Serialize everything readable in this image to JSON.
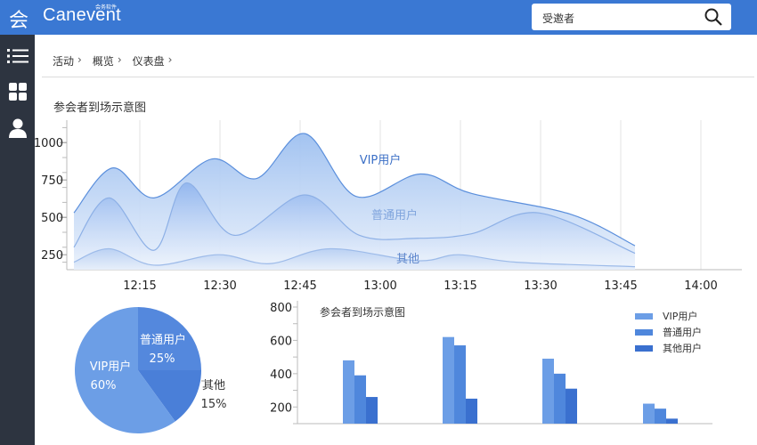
{
  "app": {
    "logo_mark": "会",
    "logo_text": "Canevent",
    "logo_sub": "会务软件"
  },
  "search": {
    "value": "受邀者"
  },
  "sidebar": {
    "items": [
      {
        "icon": "list-icon"
      },
      {
        "icon": "grid-icon"
      },
      {
        "icon": "user-icon"
      }
    ]
  },
  "breadcrumb": {
    "items": [
      "活动",
      "概览",
      "仪表盘"
    ]
  },
  "main_title": "参会者到场示意图",
  "colors": {
    "accent": "#3a78d3",
    "sidebar": "#2d3440",
    "vip": "#6b9fe6",
    "normal": "#4f87dc",
    "other": "#3b71cf"
  },
  "chart_data": [
    {
      "type": "area",
      "title": "参会者到场示意图",
      "x": [
        "12:15",
        "12:30",
        "12:45",
        "13:00",
        "13:15",
        "13:30",
        "13:45",
        "14:00"
      ],
      "ylim": [
        150,
        1150
      ],
      "yticks": [
        250,
        500,
        750,
        1000
      ],
      "grid": true,
      "series": [
        {
          "name": "VIP用户",
          "points": [
            [
              12.05,
              530
            ],
            [
              12.17,
              830
            ],
            [
              12.3,
              630
            ],
            [
              12.48,
              890
            ],
            [
              12.62,
              760
            ],
            [
              12.77,
              1060
            ],
            [
              12.93,
              640
            ],
            [
              13.13,
              790
            ],
            [
              13.29,
              660
            ],
            [
              13.6,
              520
            ],
            [
              13.8,
              310
            ]
          ]
        },
        {
          "name": "普通用户",
          "points": [
            [
              12.05,
              300
            ],
            [
              12.16,
              630
            ],
            [
              12.3,
              280
            ],
            [
              12.4,
              730
            ],
            [
              12.55,
              380
            ],
            [
              12.77,
              650
            ],
            [
              12.94,
              380
            ],
            [
              13.12,
              360
            ],
            [
              13.29,
              390
            ],
            [
              13.5,
              530
            ],
            [
              13.8,
              260
            ]
          ]
        },
        {
          "name": "其他",
          "points": [
            [
              12.05,
              200
            ],
            [
              12.16,
              290
            ],
            [
              12.3,
              180
            ],
            [
              12.5,
              250
            ],
            [
              12.66,
              190
            ],
            [
              12.85,
              290
            ],
            [
              13.12,
              210
            ],
            [
              13.25,
              250
            ],
            [
              13.43,
              200
            ],
            [
              13.8,
              170
            ]
          ]
        }
      ]
    },
    {
      "type": "pie",
      "slices": [
        {
          "name": "VIP用户",
          "percent": "60%",
          "value": 60
        },
        {
          "name": "普通用户",
          "percent": "25%",
          "value": 25
        },
        {
          "name": "其他",
          "percent": "15%",
          "value": 15
        }
      ]
    },
    {
      "type": "bar",
      "title": "参会者到场示意图",
      "ylim": [
        100,
        800
      ],
      "yticks": [
        200,
        400,
        600,
        800
      ],
      "groups": 4,
      "series": [
        {
          "name": "VIP用户",
          "values": [
            480,
            620,
            490,
            220
          ]
        },
        {
          "name": "普通用户",
          "values": [
            390,
            570,
            400,
            190
          ]
        },
        {
          "name": "其他用户",
          "values": [
            260,
            250,
            310,
            130
          ]
        }
      ]
    }
  ]
}
